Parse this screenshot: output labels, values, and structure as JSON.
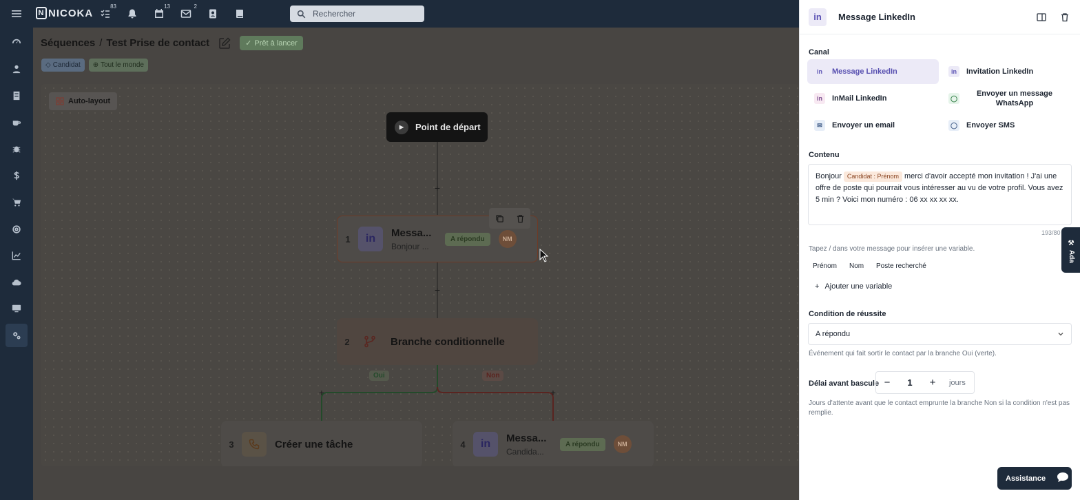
{
  "topbar": {
    "logo": "NICOKA",
    "badges": {
      "tasks": "83",
      "calendar": "13",
      "mail": "2"
    },
    "search_placeholder": "Rechercher"
  },
  "header": {
    "breadcrumb_root": "Séquences",
    "separator": "/",
    "sequence_name": "Test Prise de contact",
    "status": "Prêt à lancer",
    "tags": [
      "Candidat",
      "Tout le monde"
    ]
  },
  "canvas": {
    "autolayout_label": "Auto-layout",
    "start_label": "Point de départ",
    "nodes": [
      {
        "num": "1",
        "title": "Messa...",
        "subtitle": "Bonjour ...",
        "badge": "A répondu",
        "avatar": "NM"
      },
      {
        "num": "2",
        "title": "Branche conditionnelle"
      },
      {
        "num": "3",
        "title": "Créer une tâche"
      },
      {
        "num": "4",
        "title": "Messa...",
        "subtitle": "Candida...",
        "badge": "A répondu",
        "avatar": "NM"
      }
    ],
    "branch_yes": "Oui",
    "branch_no": "Non"
  },
  "panel": {
    "title": "Message LinkedIn",
    "canal_label": "Canal",
    "canal_options": [
      "Message LinkedIn",
      "Invitation LinkedIn",
      "InMail LinkedIn",
      "Envoyer un message WhatsApp",
      "Envoyer un email",
      "Envoyer SMS"
    ],
    "content_label": "Contenu",
    "content_before": "Bonjour",
    "content_variable": "Candidat : Prénom",
    "content_after": "merci d'avoir accepté mon invitation ! J'ai une offre de poste qui pourrait vous intéresser au vu de votre profil. Vous avez 5 min ? Voici mon numéro : 06 xx xx xx xx.",
    "counter": "193/80",
    "variable_hint": "Tapez / dans votre message pour insérer une variable.",
    "variables": [
      "Prénom",
      "Nom",
      "Poste recherché"
    ],
    "add_variable": "Ajouter une variable",
    "condition_label": "Condition de réussite",
    "condition_value": "A répondu",
    "condition_hint": "Événement qui fait sortir le contact par la branche Oui (verte).",
    "delay_label": "Délai avant bascule",
    "delay_minus": "−",
    "delay_value": "1",
    "delay_plus": "+",
    "delay_unit": "jours",
    "delay_hint": "Jours d'attente avant que le contact emprunte la branche Non si la condition n'est pas remplie.",
    "assistance_label": "Assistance",
    "ada_label": "Ada"
  },
  "colors": {
    "sidebar": "#1e2b3b",
    "linkedin_accent": "#574fb0",
    "success_line": "#2e7d43",
    "fail_line": "#b03a2e"
  }
}
